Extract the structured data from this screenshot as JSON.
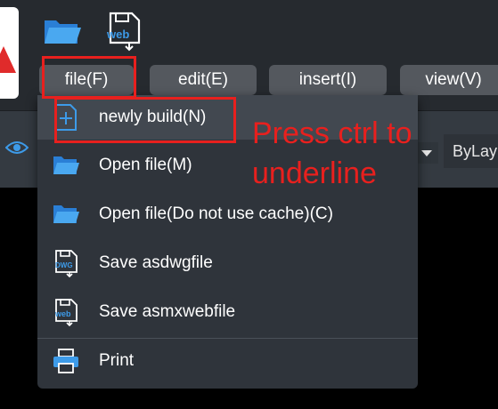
{
  "quick_icons": {
    "web_label": "web"
  },
  "menubar": {
    "tabs": [
      {
        "label": "file(F)"
      },
      {
        "label": "edit(E)"
      },
      {
        "label": "insert(I)"
      },
      {
        "label": "view(V)"
      }
    ]
  },
  "toolbar": {
    "layer_combo_value": "ByLay"
  },
  "file_menu": {
    "items": [
      {
        "label": "newly build(N)",
        "icon": "new-file-icon"
      },
      {
        "label": "Open file(M)",
        "icon": "folder-icon"
      },
      {
        "label": "Open file(Do not use cache)(C)",
        "icon": "folder-icon"
      },
      {
        "label": "Save asdwgfile",
        "icon": "save-dwg-icon",
        "badge": "DWG"
      },
      {
        "label": "Save asmxwebfile",
        "icon": "save-web-icon",
        "badge": "web"
      },
      {
        "label": "Print",
        "icon": "printer-icon"
      }
    ]
  },
  "annotation": {
    "text": "Press ctrl to underline",
    "color": "#e8201e"
  },
  "colors": {
    "accent_blue": "#3d9be9",
    "menu_bg": "#2f343b",
    "tab_bg": "#54585e",
    "annotation_red": "#e8201e"
  }
}
